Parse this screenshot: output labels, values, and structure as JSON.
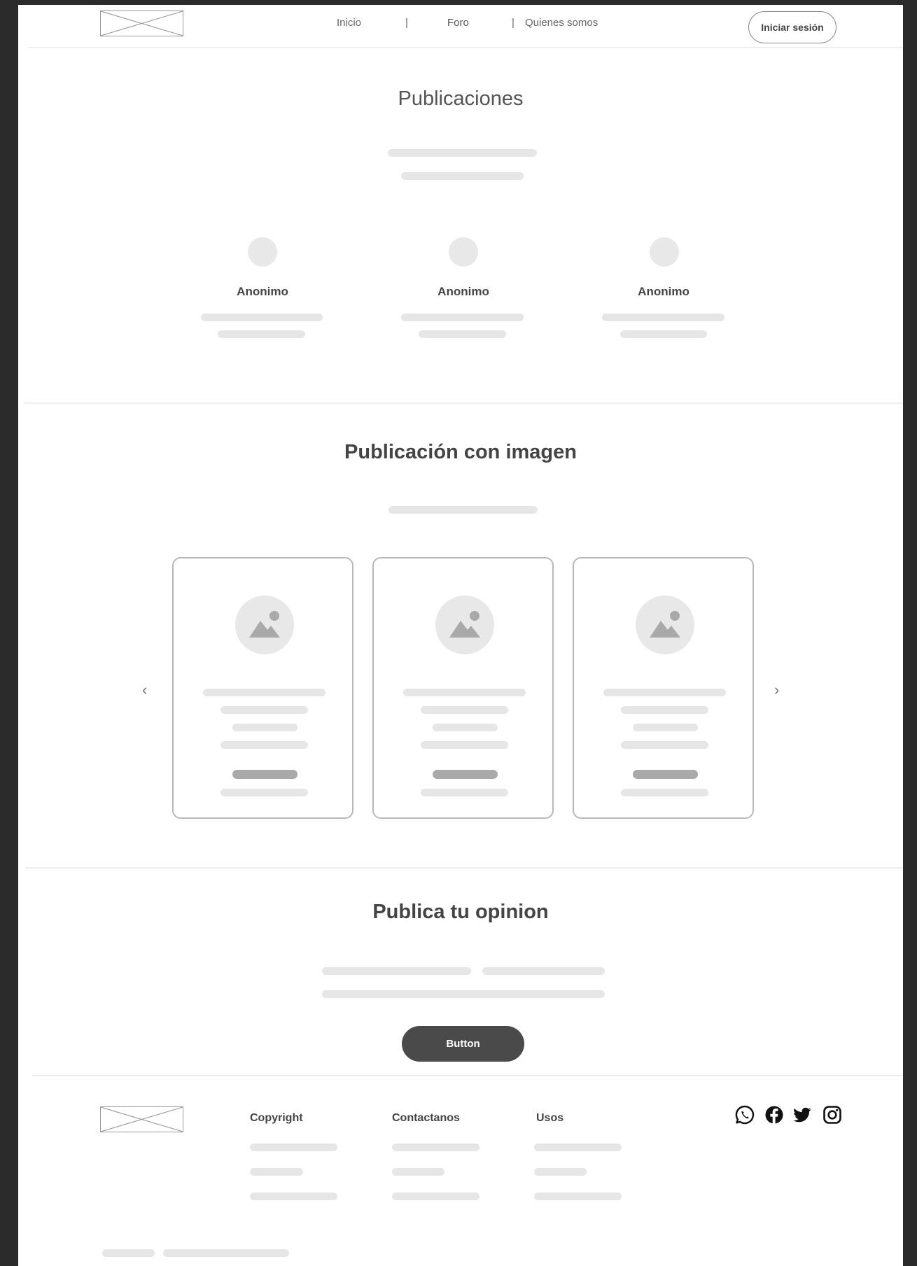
{
  "nav": {
    "links": [
      "Inicio",
      "Foro",
      "Quienes somos"
    ],
    "separator": "|",
    "login_label": "Iniciar sesión"
  },
  "publicaciones": {
    "title": "Publicaciones",
    "authors": [
      "Anonimo",
      "Anonimo",
      "Anonimo"
    ]
  },
  "imagen": {
    "title": "Publicación con imagen",
    "prev_arrow": "‹",
    "next_arrow": "›"
  },
  "opinion": {
    "title": "Publica tu opinion",
    "button_label": "Button"
  },
  "footer": {
    "columns": [
      "Copyright",
      "Contactanos",
      "Usos"
    ],
    "social_icons": [
      "whatsapp-icon",
      "facebook-icon",
      "twitter-icon",
      "instagram-icon"
    ]
  },
  "colors": {
    "background": "#2b2b2b",
    "page": "#ffffff",
    "placeholder": "#e6e6e6",
    "button": "#4a4a4a"
  }
}
